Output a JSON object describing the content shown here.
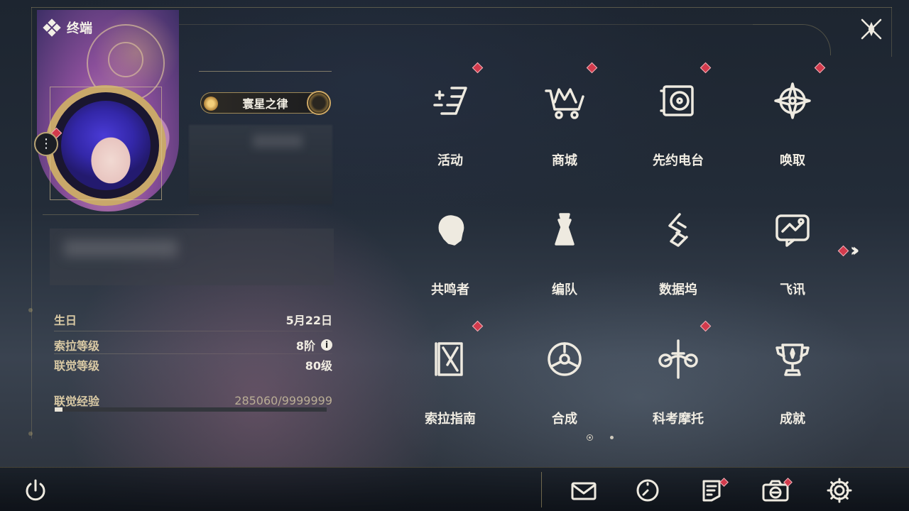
{
  "header": {
    "title": "终端"
  },
  "profile": {
    "name_banner": "寰星之律"
  },
  "stats": {
    "birthday": {
      "label": "生日",
      "value": "5月22日"
    },
    "sola_level": {
      "label": "索拉等级",
      "value": "8阶"
    },
    "union_level": {
      "label": "联觉等级",
      "value": "80级"
    },
    "union_exp": {
      "label": "联觉经验",
      "value": "285060/9999999",
      "progress": 0.0285
    }
  },
  "menu": [
    {
      "id": "events",
      "label": "活动",
      "icon": "events-icon",
      "badge": true
    },
    {
      "id": "shop",
      "label": "商城",
      "icon": "shop-crown-icon",
      "badge": true
    },
    {
      "id": "radio",
      "label": "先约电台",
      "icon": "radio-icon",
      "badge": true
    },
    {
      "id": "convene",
      "label": "唤取",
      "icon": "compass-star-icon",
      "badge": true
    },
    {
      "id": "resonators",
      "label": "共鸣者",
      "icon": "resonator-portrait-icon",
      "badge": false
    },
    {
      "id": "team",
      "label": "编队",
      "icon": "chess-team-icon",
      "badge": false
    },
    {
      "id": "databank",
      "label": "数据坞",
      "icon": "databank-icon",
      "badge": false
    },
    {
      "id": "messenger",
      "label": "飞讯",
      "icon": "chat-icon",
      "badge": false
    },
    {
      "id": "guidebook",
      "label": "索拉指南",
      "icon": "guidebook-icon",
      "badge": true
    },
    {
      "id": "synthesis",
      "label": "合成",
      "icon": "synthesis-icon",
      "badge": false
    },
    {
      "id": "motorbike",
      "label": "科考摩托",
      "icon": "motorbike-icon",
      "badge": true
    },
    {
      "id": "achievements",
      "label": "成就",
      "icon": "trophy-icon",
      "badge": false
    }
  ],
  "pager": {
    "current": 1,
    "total": 2
  },
  "bottom_bar": [
    {
      "id": "mail",
      "icon": "mail-icon",
      "badge": false
    },
    {
      "id": "clock",
      "icon": "clock-icon",
      "badge": false
    },
    {
      "id": "notice",
      "icon": "notice-icon",
      "badge": true
    },
    {
      "id": "camera",
      "icon": "camera-icon",
      "badge": true
    },
    {
      "id": "settings",
      "icon": "gear-icon",
      "badge": false
    }
  ],
  "colors": {
    "accent_gold": "#c9a86a",
    "badge_red": "#d23a4c",
    "text": "#f1ede3",
    "label_gold": "#d9c9a4"
  }
}
